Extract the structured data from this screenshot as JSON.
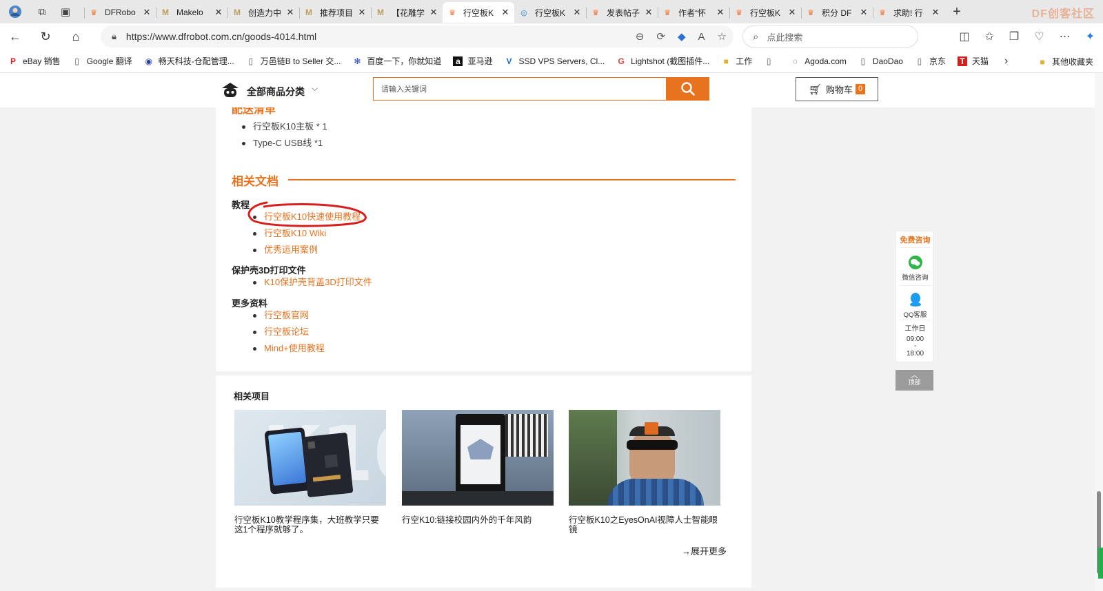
{
  "browser": {
    "tabs": [
      {
        "title": "DFRobo",
        "favicon": "dfrobot"
      },
      {
        "title": "Makelo",
        "favicon": "m"
      },
      {
        "title": "创造力中",
        "favicon": "m"
      },
      {
        "title": "推荐项目",
        "favicon": "m"
      },
      {
        "title": "【花雕学",
        "favicon": "m"
      },
      {
        "title": "行空板K",
        "favicon": "dfrobot",
        "active": true
      },
      {
        "title": "行空板K",
        "favicon": "edge"
      },
      {
        "title": "发表帖子",
        "favicon": "dfrobot"
      },
      {
        "title": "作者“怀",
        "favicon": "dfrobot"
      },
      {
        "title": "行空板K",
        "favicon": "dfrobot"
      },
      {
        "title": "积分 DF",
        "favicon": "dfrobot"
      },
      {
        "title": "求助! 行",
        "favicon": "dfrobot"
      }
    ],
    "tabbar_logo": "DF创客社区",
    "url": "https://www.dfrobot.com.cn/goods-4014.html",
    "search_placeholder": "点此搜索",
    "bookmarks": [
      {
        "label": "eBay 销售",
        "icon": "p-icon"
      },
      {
        "label": "Google 翻译",
        "icon": "page-icon"
      },
      {
        "label": "畅天科技-仓配管理...",
        "icon": "globe-icon"
      },
      {
        "label": "万邑链B to Seller 交...",
        "icon": "page-icon"
      },
      {
        "label": "百度一下，你就知道",
        "icon": "baidu-icon"
      },
      {
        "label": "亚马逊",
        "icon": "amazon-icon"
      },
      {
        "label": "SSD VPS Servers, Cl...",
        "icon": "v-icon"
      },
      {
        "label": "Lightshot (截图插件...",
        "icon": "google-icon"
      },
      {
        "label": "工作",
        "icon": "folder-icon"
      },
      {
        "label": "",
        "icon": "page-icon"
      },
      {
        "label": "Agoda.com",
        "icon": "agoda-icon"
      },
      {
        "label": "DaoDao",
        "icon": "page-icon"
      },
      {
        "label": "京东",
        "icon": "page-icon"
      },
      {
        "label": "天猫",
        "icon": "tmall-icon"
      }
    ],
    "other_bookmarks": "其他收藏夹"
  },
  "site": {
    "category_label": "全部商品分类",
    "search_placeholder": "请输入关键词",
    "cart_label": "购物车",
    "cart_count": "0"
  },
  "content": {
    "cut_heading": "配送清单",
    "package_items": [
      "行空板K10主板 * 1",
      "Type-C USB线 *1"
    ],
    "docs_heading": "相关文档",
    "groups": [
      {
        "label": "教程",
        "links": [
          "行空板K10快速使用教程",
          "行空板K10 Wiki",
          "优秀运用案例"
        ]
      },
      {
        "label": "保护壳3D打印文件",
        "links": [
          "K10保护壳背盖3D打印文件"
        ]
      },
      {
        "label": "更多资料",
        "links": [
          "行空板官网",
          "行空板论坛",
          "Mind+使用教程"
        ]
      }
    ],
    "projects_title": "相关项目",
    "projects": [
      {
        "caption": "行空板K10教学程序集，大班教学只要这1个程序就够了。"
      },
      {
        "caption": "行空K10:链接校园内外的千年风韵"
      },
      {
        "caption": "行空板K10之EyesOnAI视障人士智能眼镜"
      }
    ],
    "more_label": "→展开更多"
  },
  "widget": {
    "consult": "免费咨询",
    "wechat": "微信咨询",
    "qq": "QQ客服",
    "hours_label": "工作日",
    "hours_start": "09:00",
    "hours_sep": "-",
    "hours_end": "18:00",
    "to_top": "顶部"
  },
  "colors": {
    "accent": "#e8731f",
    "annotation": "#d91e1e"
  }
}
